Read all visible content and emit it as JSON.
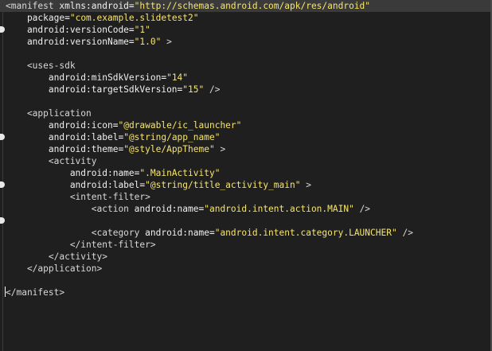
{
  "lines": [
    [
      {
        "t": "t",
        "s": "<manifest "
      },
      {
        "t": "a",
        "s": "xmlns:android"
      },
      {
        "t": "e",
        "s": "="
      },
      {
        "t": "v",
        "s": "\"http://schemas.android.com/apk/res/android\""
      }
    ],
    [
      {
        "t": "a",
        "s": "    package"
      },
      {
        "t": "e",
        "s": "="
      },
      {
        "t": "v",
        "s": "\"com.example.slidetest2\""
      }
    ],
    [
      {
        "t": "a",
        "s": "    android:versionCode"
      },
      {
        "t": "e",
        "s": "="
      },
      {
        "t": "v",
        "s": "\"1\""
      }
    ],
    [
      {
        "t": "a",
        "s": "    android:versionName"
      },
      {
        "t": "e",
        "s": "="
      },
      {
        "t": "v",
        "s": "\"1.0\""
      },
      {
        "t": "t",
        "s": " >"
      }
    ],
    [],
    [
      {
        "t": "t",
        "s": "    <uses-sdk"
      }
    ],
    [
      {
        "t": "a",
        "s": "        android:minSdkVersion"
      },
      {
        "t": "e",
        "s": "="
      },
      {
        "t": "v",
        "s": "\"14\""
      }
    ],
    [
      {
        "t": "a",
        "s": "        android:targetSdkVersion"
      },
      {
        "t": "e",
        "s": "="
      },
      {
        "t": "v",
        "s": "\"15\""
      },
      {
        "t": "t",
        "s": " />"
      }
    ],
    [],
    [
      {
        "t": "t",
        "s": "    <application"
      }
    ],
    [
      {
        "t": "a",
        "s": "        android:icon"
      },
      {
        "t": "e",
        "s": "="
      },
      {
        "t": "v",
        "s": "\"@drawable/ic_launcher\""
      }
    ],
    [
      {
        "t": "a",
        "s": "        android:label"
      },
      {
        "t": "e",
        "s": "="
      },
      {
        "t": "v",
        "s": "\"@string/app_name\""
      }
    ],
    [
      {
        "t": "a",
        "s": "        android:theme"
      },
      {
        "t": "e",
        "s": "="
      },
      {
        "t": "v",
        "s": "\"@style/AppTheme\""
      },
      {
        "t": "t",
        "s": " >"
      }
    ],
    [
      {
        "t": "t",
        "s": "        <activity"
      }
    ],
    [
      {
        "t": "a",
        "s": "            android:name"
      },
      {
        "t": "e",
        "s": "="
      },
      {
        "t": "v",
        "s": "\".MainActivity\""
      }
    ],
    [
      {
        "t": "a",
        "s": "            android:label"
      },
      {
        "t": "e",
        "s": "="
      },
      {
        "t": "v",
        "s": "\"@string/title_activity_main\""
      },
      {
        "t": "t",
        "s": " >"
      }
    ],
    [
      {
        "t": "t",
        "s": "            <intent-filter>"
      }
    ],
    [
      {
        "t": "t",
        "s": "                <action "
      },
      {
        "t": "a",
        "s": "android:name"
      },
      {
        "t": "e",
        "s": "="
      },
      {
        "t": "v",
        "s": "\"android.intent.action.MAIN\""
      },
      {
        "t": "t",
        "s": " />"
      }
    ],
    [],
    [
      {
        "t": "t",
        "s": "                <category "
      },
      {
        "t": "a",
        "s": "android:name"
      },
      {
        "t": "e",
        "s": "="
      },
      {
        "t": "v",
        "s": "\"android.intent.category.LAUNCHER\""
      },
      {
        "t": "t",
        "s": " />"
      }
    ],
    [
      {
        "t": "t",
        "s": "            </intent-filter>"
      }
    ],
    [
      {
        "t": "t",
        "s": "        </activity>"
      }
    ],
    [
      {
        "t": "t",
        "s": "    </application>"
      }
    ],
    [],
    [
      {
        "t": "t",
        "s": "</manifest>"
      }
    ]
  ]
}
